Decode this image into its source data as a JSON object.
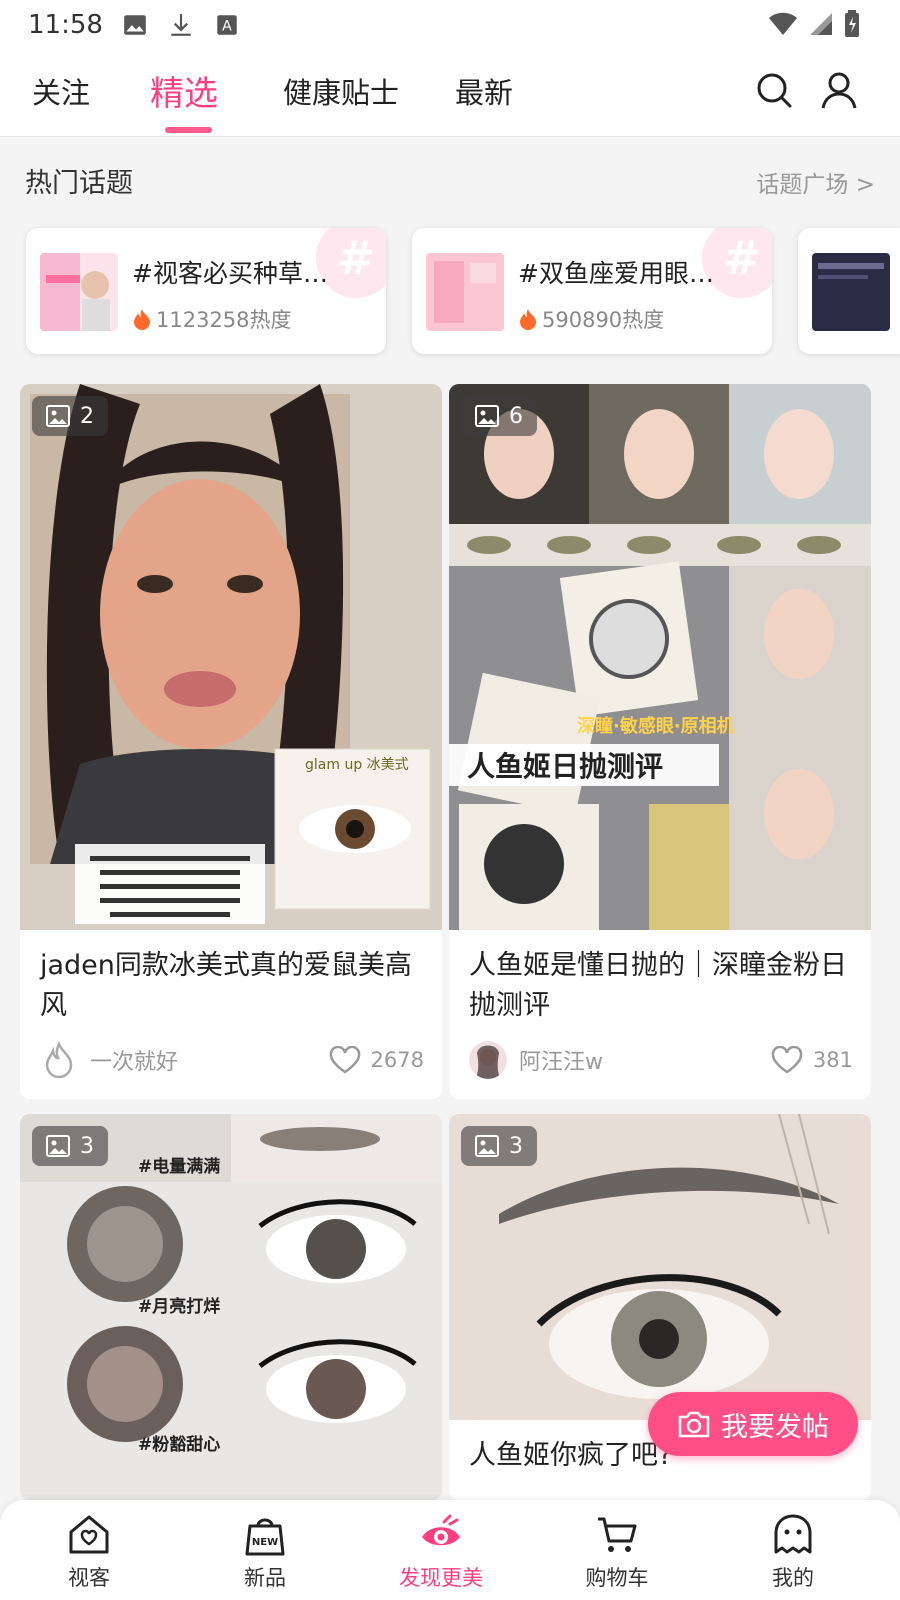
{
  "status_bar": {
    "time": "11:58"
  },
  "tabs": [
    {
      "label": "关注"
    },
    {
      "label": "精选"
    },
    {
      "label": "健康贴士"
    },
    {
      "label": "最新"
    }
  ],
  "active_tab": "精选",
  "hot_topics": {
    "title": "热门话题",
    "more": "话题广场 >",
    "items": [
      {
        "name": "#视客必买种草…",
        "heat": "1123258热度"
      },
      {
        "name": "#双鱼座爱用眼…",
        "heat": "590890热度"
      }
    ]
  },
  "feed": [
    {
      "image_count": "2",
      "title": "jaden同款冰美式真的爱鼠美高风",
      "author": "一次就好",
      "likes": "2678",
      "overlay_text": "glam up 冰美式"
    },
    {
      "image_count": "6",
      "title": "人鱼姬是懂日抛的｜深瞳金粉日抛测评",
      "author": "阿汪汪w",
      "likes": "381",
      "overlay_text": "人鱼姬日抛测评",
      "overlay_text2": "深瞳·敏感眼·原相机"
    },
    {
      "image_count": "3",
      "title": "",
      "overlay_tags": [
        "#电量满满",
        "#月亮打烊",
        "#粉豁甜心"
      ]
    },
    {
      "image_count": "3",
      "title": "人鱼姬你疯了吧?"
    }
  ],
  "post_button": "我要发帖",
  "bottom_nav": [
    {
      "label": "视客",
      "icon": "home-heart-icon"
    },
    {
      "label": "新品",
      "icon": "new-bag-icon"
    },
    {
      "label": "发现更美",
      "icon": "eye-icon"
    },
    {
      "label": "购物车",
      "icon": "cart-icon"
    },
    {
      "label": "我的",
      "icon": "profile-icon"
    }
  ],
  "colors": {
    "accent": "#ff3f80",
    "button": "#ff4f86"
  }
}
